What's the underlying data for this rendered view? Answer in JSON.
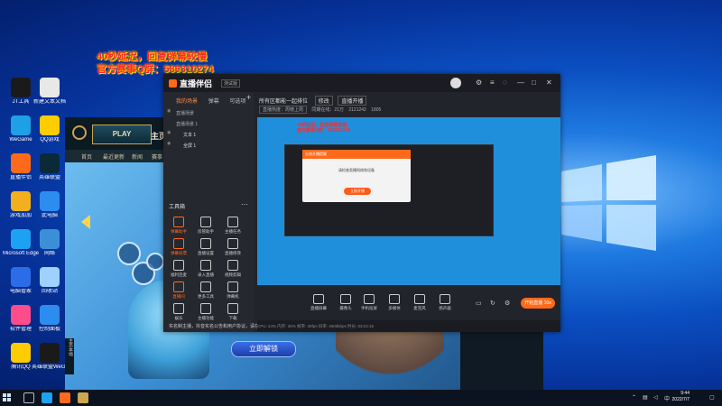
{
  "overlay": {
    "line1": "40秒延迟，回复弹幕较慢",
    "line2": "官方赛事Q群：589310274"
  },
  "desktop_icons": [
    {
      "label": "JT工具",
      "color": "#1a1a1a"
    },
    {
      "label": "新建文本文档",
      "color": "#e8e8e8"
    },
    {
      "label": "WeGame",
      "color": "#1ea0e6"
    },
    {
      "label": "QQ游戏",
      "color": "#ffcc00"
    },
    {
      "label": "直播伴侣",
      "color": "#ff6a1a"
    },
    {
      "label": "英雄联盟",
      "color": "#0a2a3a"
    },
    {
      "label": "游戏加加",
      "color": "#f2b01e"
    },
    {
      "label": "此电脑",
      "color": "#2d8cf0"
    },
    {
      "label": "Microsoft Edge",
      "color": "#1da1f2"
    },
    {
      "label": "网络",
      "color": "#3b8fd6"
    },
    {
      "label": "电脑管家",
      "color": "#2b6de8"
    },
    {
      "label": "回收站",
      "color": "#9fd0ff"
    },
    {
      "label": "软件管理",
      "color": "#ff4d8c"
    },
    {
      "label": "控制面板",
      "color": "#2d8cf0"
    },
    {
      "label": "腾讯QQ",
      "color": "#ffcc00"
    },
    {
      "label": "英雄联盟WeGame版",
      "color": "#1a1a1a"
    }
  ],
  "game": {
    "play_label": "PLAY",
    "home_title": "主页",
    "nav": [
      "首页",
      "最近更新",
      "新闻",
      "赛事"
    ],
    "unlock_label": "立即解锁",
    "side_label": "主页本地"
  },
  "app": {
    "title": "直播伴侣",
    "version": "测试版",
    "tabs": [
      "我的场景",
      "弹幕",
      "可选项"
    ],
    "scenes": [
      "直播场景",
      "直播场景 1",
      "文本 1",
      "全屏 1"
    ],
    "room_title": "所有区都能一起排位",
    "room_pill": "修改",
    "room_btn": "直播开播",
    "room_stats": [
      "直播热度：周榜上周",
      "同期在线：21万",
      "2121242",
      "1805"
    ],
    "tools_title": "工具箱",
    "tools": [
      {
        "label": "弹幕助手",
        "hot": true
      },
      {
        "label": "房管助手",
        "hot": false
      },
      {
        "label": "主播任务",
        "hot": false
      },
      {
        "label": "弹幕投票",
        "hot": true
      },
      {
        "label": "直播设置",
        "hot": false
      },
      {
        "label": "直播修改",
        "hot": false
      },
      {
        "label": "福利连麦",
        "hot": false
      },
      {
        "label": "录入直播",
        "hot": false
      },
      {
        "label": "视频剪辑",
        "hot": false
      },
      {
        "label": "直播间",
        "hot": true
      },
      {
        "label": "更多工具",
        "hot": false
      },
      {
        "label": "弹幕机",
        "hot": false
      },
      {
        "label": "娱乐",
        "hot": false
      },
      {
        "label": "主播功能",
        "hot": false
      },
      {
        "label": "下载",
        "hot": false
      }
    ],
    "notice": "实名制主播，抖音实名公告和用户协议，请在这里查看",
    "preview_red": [
      "40秒延迟，回复弹幕较慢",
      "官方赛事Q群：589310274"
    ],
    "preview_dialog_title": "分流开播提醒",
    "preview_dialog_text": "请检查直播网络和设备",
    "preview_dialog_btn": "立即开播",
    "bottom_tools": [
      "直播屏幕",
      "摄像头",
      "手机投屏",
      "多媒体",
      "麦克风",
      "扬声器"
    ],
    "golive_label": "开始直播 10s",
    "status": "CPU: 24%    内存: 36%    帧率: 30fps    码率: 4600kbps    时长: 03:24:18"
  },
  "taskbar": {
    "time": "9:44",
    "date": "2022/7/7",
    "lang": "中"
  }
}
